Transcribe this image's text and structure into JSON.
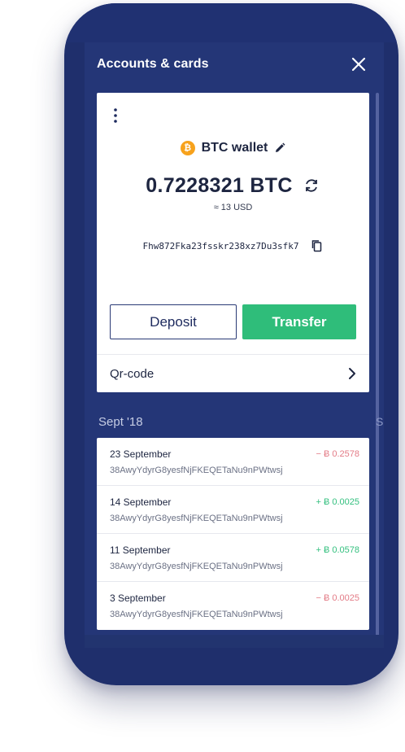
{
  "header": {
    "title": "Accounts & cards"
  },
  "wallet_card": {
    "coin_symbol": "₿",
    "wallet_name": "BTC wallet",
    "balance": "0.7228321 BTC",
    "fiat_value": "≈ 13 USD",
    "address": "Fhw872Fka23fsskr238xz7Du3sfk7",
    "deposit_label": "Deposit",
    "transfer_label": "Transfer",
    "qr_label": "Qr-code"
  },
  "history": {
    "section_title": "Sept '18",
    "peek_letter": "S",
    "transactions": [
      {
        "date": "23 September",
        "hash": "38AwyYdyrG8yesfNjFKEQETaNu9nPWtwsj",
        "amount": "− Ƀ 0.2578",
        "direction": "out"
      },
      {
        "date": "14 September",
        "hash": "38AwyYdyrG8yesfNjFKEQETaNu9nPWtwsj",
        "amount": "+ Ƀ 0.0025",
        "direction": "in"
      },
      {
        "date": "11 September",
        "hash": "38AwyYdyrG8yesfNjFKEQETaNu9nPWtwsj",
        "amount": "+ Ƀ 0.0578",
        "direction": "in"
      },
      {
        "date": "3 September",
        "hash": "38AwyYdyrG8yesfNjFKEQETaNu9nPWtwsj",
        "amount": "− Ƀ 0.0025",
        "direction": "out"
      }
    ]
  },
  "colors": {
    "phone_frame": "#1f2f6c",
    "screen_bg": "#243677",
    "transfer_green": "#2fbd7a",
    "btc_orange": "#f7a21c",
    "negative_amount": "#e37b86",
    "positive_amount": "#34c07f"
  },
  "icons": {
    "close": "close-icon",
    "menu": "kebab-icon",
    "coin": "btc-coin-icon",
    "edit": "edit-icon",
    "refresh": "refresh-icon",
    "copy": "copy-icon",
    "chevron": "chevron-right-icon"
  }
}
